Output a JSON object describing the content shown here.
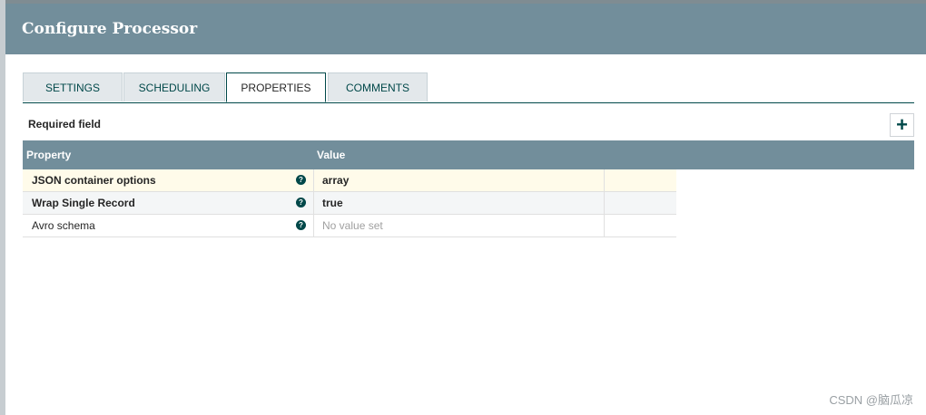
{
  "dialog": {
    "title": "Configure Processor"
  },
  "tabs": [
    {
      "label": "SETTINGS"
    },
    {
      "label": "SCHEDULING"
    },
    {
      "label": "PROPERTIES"
    },
    {
      "label": "COMMENTS"
    }
  ],
  "active_tab": "PROPERTIES",
  "required_label": "Required field",
  "add_button_label": "+",
  "table": {
    "headers": {
      "property": "Property",
      "value": "Value"
    },
    "rows": [
      {
        "property": "JSON container options",
        "value": "array",
        "required": true,
        "help_icon": "question-circle-icon"
      },
      {
        "property": "Wrap Single Record",
        "value": "true",
        "required": true,
        "help_icon": "question-circle-icon"
      },
      {
        "property": "Avro schema",
        "value": "No value set",
        "required": false,
        "help_icon": "question-circle-icon"
      }
    ]
  },
  "help_glyph": "?",
  "watermark": "CSDN @脑瓜凉",
  "colors": {
    "header_bg": "#728e9b",
    "accent": "#004849",
    "highlight_row": "#fffbea"
  }
}
